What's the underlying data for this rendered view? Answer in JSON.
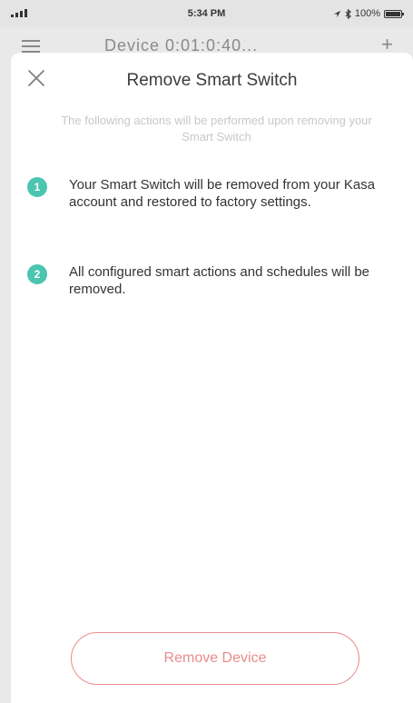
{
  "status_bar": {
    "time": "5:34 PM",
    "battery": "100%",
    "icons": [
      "signal-icon",
      "location-icon",
      "bluetooth-icon",
      "battery-icon"
    ]
  },
  "background_screen": {
    "title": "Device 0:01:0:40...",
    "icons": [
      "menu-icon",
      "add-icon"
    ]
  },
  "modal": {
    "title": "Remove Smart Switch",
    "subtitle": "The following actions will be performed upon removing your Smart Switch",
    "close_icon": "close-icon",
    "steps": [
      {
        "number": "1",
        "text": "Your Smart Switch will be removed from your Kasa account and restored to factory settings."
      },
      {
        "number": "2",
        "text": "All configured smart actions and schedules will be removed."
      }
    ],
    "action_button": "Remove Device"
  },
  "colors": {
    "accent_teal": "#4cc5b0",
    "danger": "#e88c8c",
    "title_text": "#3c3c3c",
    "muted_text": "#c8c8c8"
  }
}
